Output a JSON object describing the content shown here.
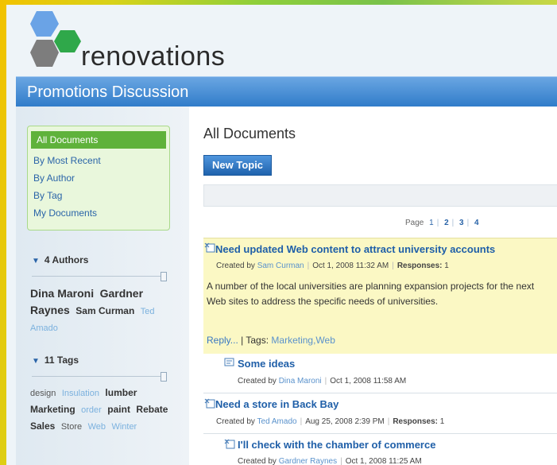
{
  "brand": {
    "logo_text": "renovations"
  },
  "page": {
    "title": "Promotions Discussion"
  },
  "sidebar": {
    "nav": [
      {
        "label": "All Documents",
        "active": true
      },
      {
        "label": "By Most Recent"
      },
      {
        "label": "By Author"
      },
      {
        "label": "By Tag"
      },
      {
        "label": "My Documents"
      }
    ],
    "authors": {
      "header": "4 Authors",
      "cloud": [
        "Dina Maroni",
        "Gardner Raynes",
        "Sam Curman",
        "Ted Amado"
      ]
    },
    "tags": {
      "header": "11 Tags",
      "cloud": [
        "design",
        "Insulation",
        "lumber",
        "Marketing",
        "order",
        "paint",
        "Rebate",
        "Sales",
        "Store",
        "Web",
        "Winter"
      ]
    }
  },
  "main": {
    "heading": "All Documents",
    "new_topic_label": "New Topic",
    "pager": {
      "label": "Page",
      "pages": [
        "1",
        "2",
        "3",
        "4"
      ]
    },
    "posts": [
      {
        "title": "Need updated Web content to attract university accounts",
        "created_by": "Created by",
        "author": "Sam Curman",
        "date": "Oct 1, 2008 11:32 AM",
        "responses_label": "Responses:",
        "responses": "1",
        "body_line1": "A number of the local universities are planning expansion projects for the next",
        "body_line2": "Web sites to address the specific needs of universities.",
        "reply_label": "Reply...",
        "tags_label": "| Tags:",
        "tags": "Marketing,Web"
      },
      {
        "title": "Some ideas",
        "created_by": "Created by",
        "author": "Dina Maroni",
        "date": "Oct 1, 2008 11:58 AM"
      },
      {
        "title": "Need a store in Back Bay",
        "created_by": "Created by",
        "author": "Ted Amado",
        "date": "Aug 25, 2008 2:39 PM",
        "responses_label": "Responses:",
        "responses": "1"
      },
      {
        "title": "I'll check with the chamber of commerce",
        "created_by": "Created by",
        "author": "Gardner Raynes",
        "date": "Oct 1, 2008 11:25 AM"
      }
    ]
  },
  "colors": {
    "accent_blue": "#2f7bc9",
    "nav_active": "#5fb23b",
    "highlight": "#fbf8c4",
    "link": "#1f5fa8"
  }
}
